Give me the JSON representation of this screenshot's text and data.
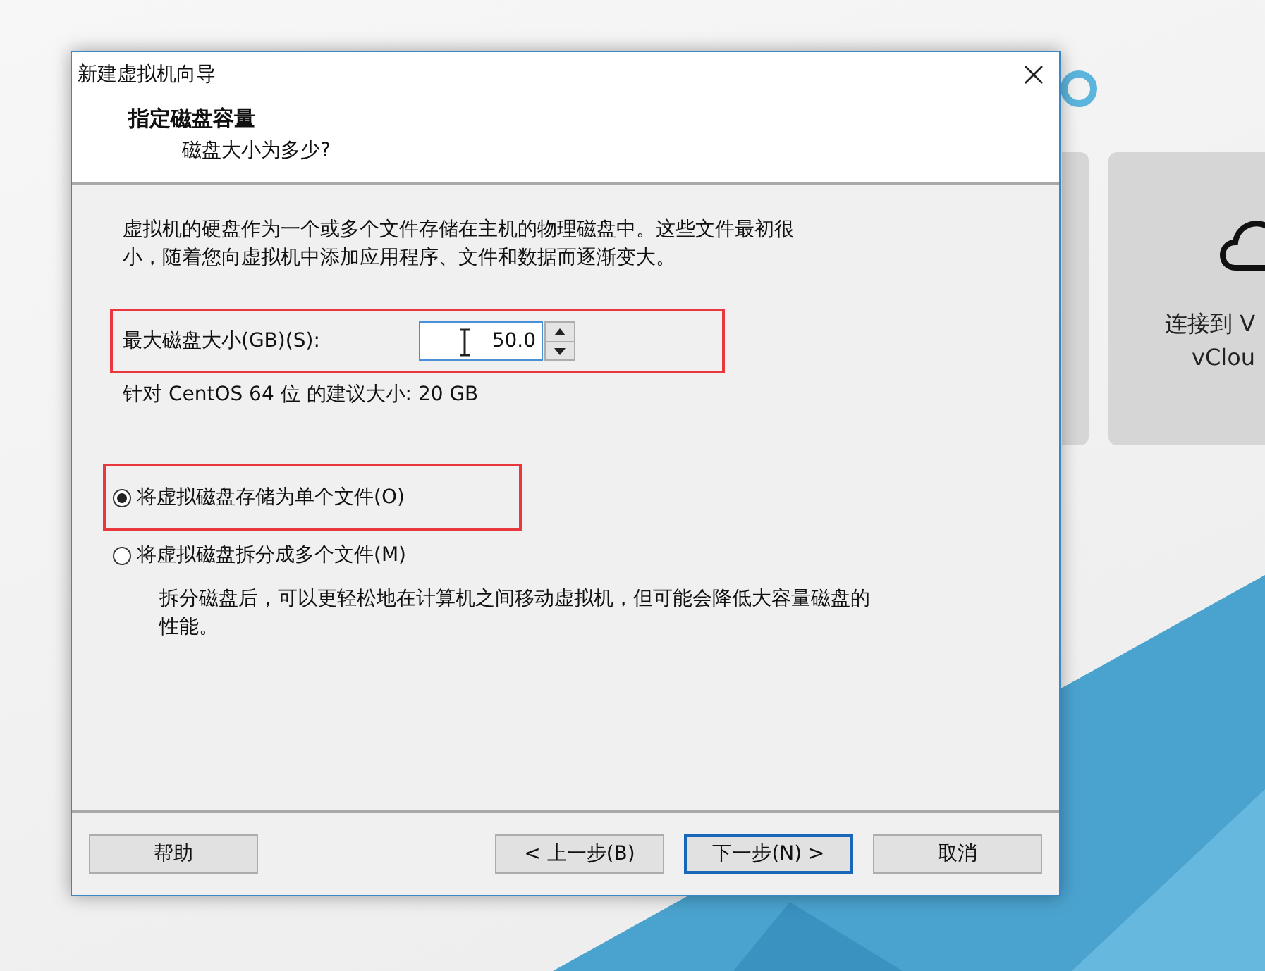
{
  "background_app": {
    "card_label_lines": [
      "连接到 V",
      "vClou"
    ]
  },
  "dialog": {
    "title": "新建虚拟机向导",
    "heading": "指定磁盘容量",
    "subheading": "磁盘大小为多少?",
    "description_lines": [
      "虚拟机的硬盘作为一个或多个文件存储在主机的物理磁盘中。这些文件最初很",
      "小，随着您向虚拟机中添加应用程序、文件和数据而逐渐变大。"
    ],
    "size_field": {
      "label": "最大磁盘大小(GB)(S):",
      "value": "50.0",
      "highlighted": true
    },
    "recommendation": "针对 CentOS 64 位 的建议大小: 20 GB",
    "storage_options": [
      {
        "label": "将虚拟磁盘存储为单个文件(O)",
        "selected": true,
        "highlighted": true
      },
      {
        "label": "将虚拟磁盘拆分成多个文件(M)",
        "selected": false,
        "highlighted": false
      }
    ],
    "split_note_lines": [
      "拆分磁盘后，可以更轻松地在计算机之间移动虚拟机，但可能会降低大容量磁盘的",
      "性能。"
    ],
    "buttons": [
      {
        "label": "帮助",
        "default": false
      },
      {
        "label": "< 上一步(B)",
        "default": false
      },
      {
        "label": "下一步(N) >",
        "default": true
      },
      {
        "label": "取消",
        "default": false
      }
    ]
  }
}
